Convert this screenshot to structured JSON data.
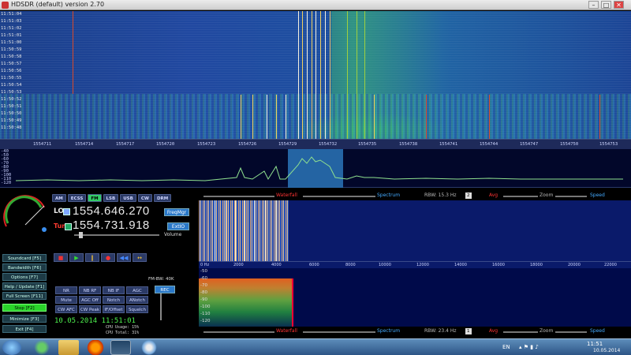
{
  "window": {
    "title": "HDSDR (default)  version 2.70",
    "minimize": "–",
    "maximize": "□",
    "close": "✕"
  },
  "waterfall_times": [
    "11:51:04",
    "11:51:03",
    "11:51:02",
    "11:51:01",
    "11:51:00",
    "11:50:59",
    "11:50:58",
    "11:50:57",
    "11:50:56",
    "11:50:55",
    "11:50:54",
    "11:50:53",
    "11:50:52",
    "11:50:51",
    "11:50:50",
    "11:50:49",
    "11:50:48"
  ],
  "freq_ticks": [
    "1554711",
    "1554714",
    "1554717",
    "1554720",
    "1554723",
    "1554726",
    "1554729",
    "1554732",
    "1554735",
    "1554738",
    "1554741",
    "1554744",
    "1554747",
    "1554750",
    "1554753"
  ],
  "spectrum_db": [
    "-40",
    "-50",
    "-60",
    "-70",
    "-80",
    "-90",
    "-100",
    "-110",
    "-120",
    "-130"
  ],
  "modes": [
    "AM",
    "ECSS",
    "FM",
    "LSB",
    "USB",
    "CW",
    "DRM"
  ],
  "active_mode": "FM",
  "lo": {
    "label": "LO",
    "frequency": "1554.646.270",
    "freqmgr": "FreqMgr"
  },
  "tune": {
    "label": "Tune",
    "frequency": "1554.731.918",
    "extio": "ExtIO",
    "volume_label": "Volume"
  },
  "transport": {
    "stop": "■",
    "play": "▶",
    "pause": "‖",
    "rec": "●",
    "rew": "◀◀",
    "loop": "↔"
  },
  "fn_buttons": [
    "Soundcard  [F5]",
    "Bandwidth  [F6]",
    "Options  [F7]",
    "Help / Update  [F1]",
    "Full Screen  [F11]",
    "Stop  [F2]",
    "Minimize  [F3]",
    "Exit  [F4]"
  ],
  "dsp_row1": [
    "NR",
    "NB RF",
    "NB IF",
    "AGC"
  ],
  "dsp_row2": [
    "Mute",
    "AGC Off",
    "Notch",
    "ANotch"
  ],
  "dsp_row3": [
    "CW AFC",
    "CW Peak",
    "IF/Offset",
    "Squelch"
  ],
  "fm_bw": "FM-BW: 40K",
  "rec_btn": "REC",
  "datetime": "10.05.2014 11:51:01",
  "cpu": [
    "CPU Usage:  15%",
    "CPU Total:  31%"
  ],
  "upper_toolbar": {
    "waterfall": "Waterfall",
    "spectrum": "Spectrum",
    "rbw": "RBW: 15.3 Hz",
    "avg_val": "2",
    "avg": "Avg",
    "zoom": "Zoom",
    "speed": "Speed"
  },
  "lower_toolbar": {
    "waterfall": "Waterfall",
    "spectrum": "Spectrum",
    "rbw": "RBW: 23.4 Hz",
    "avg_val": "1",
    "avg": "Avg",
    "zoom": "Zoom",
    "speed": "Speed"
  },
  "lower_freq_ticks": [
    "0 Hz",
    "2000",
    "4000",
    "6000",
    "8000",
    "10000",
    "12000",
    "14000",
    "16000",
    "18000",
    "20000",
    "22000"
  ],
  "lower_db": [
    "-50",
    "-60",
    "-70",
    "-80",
    "-90",
    "-100",
    "-110",
    "-120"
  ],
  "taskbar": {
    "lang": "EN",
    "time": "11:51",
    "date": "10.05.2014"
  },
  "colors": {
    "waterfall_bg": "#1f4aa0",
    "accent_blue": "#2a78c8",
    "stop_green": "#2ad32a",
    "tune_red": "#ff3b30",
    "date_green": "#4ef04e"
  }
}
